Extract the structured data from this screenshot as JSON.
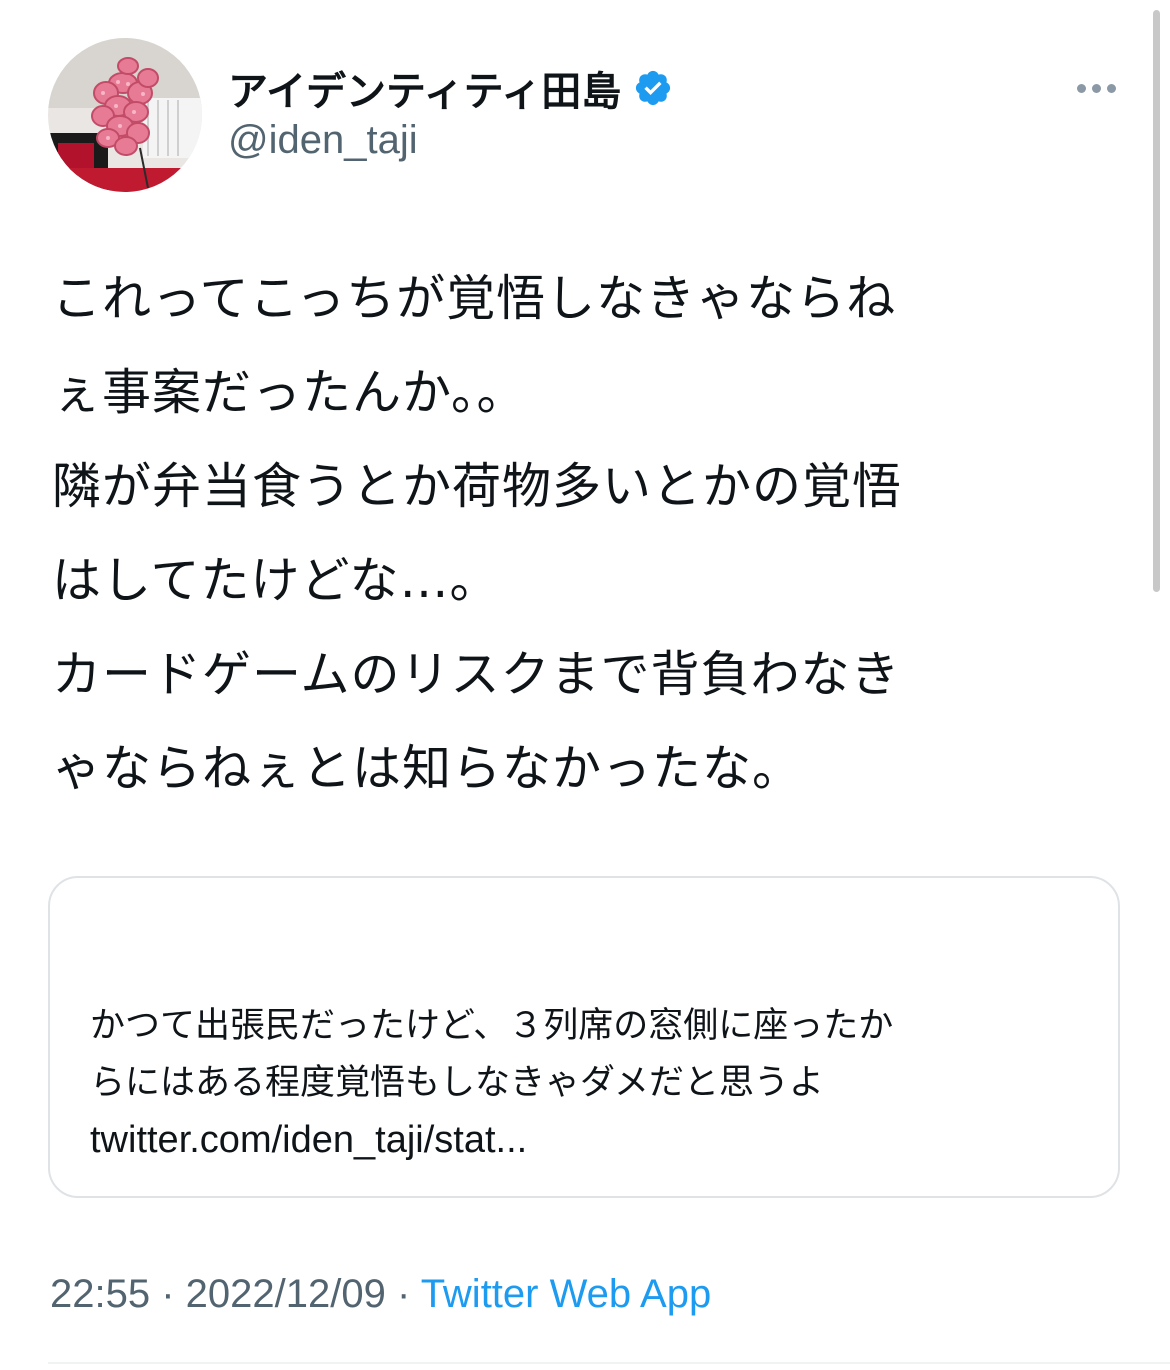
{
  "author": {
    "display_name": "アイデンティティ田島",
    "handle": "@iden_taji",
    "verified": true
  },
  "tweet": {
    "lines": [
      "これってこっちが覚悟しなきゃならね",
      "ぇ事案だったんか。。",
      "隣が弁当食うとか荷物多いとかの覚悟",
      "はしてたけどな…。",
      "カードゲームのリスクまで背負わなき",
      "ゃならねぇとは知らなかったな。"
    ]
  },
  "quoted_card": {
    "lines": [
      "かつて出張民だったけど、３列席の窓側に座ったか",
      "らにはある程度覚悟もしなきゃダメだと思うよ"
    ],
    "link": "twitter.com/iden_taji/stat..."
  },
  "meta": {
    "time": "22:55",
    "separator1": " · ",
    "date": "2022/12/09",
    "separator2": " · ",
    "source": "Twitter Web App"
  },
  "colors": {
    "text": "#0f1419",
    "secondary": "#536471",
    "accent": "#1d9bf0",
    "border": "#dfe3e6"
  },
  "icons": {
    "verified": "verified-badge-icon",
    "more": "more-options-icon"
  }
}
